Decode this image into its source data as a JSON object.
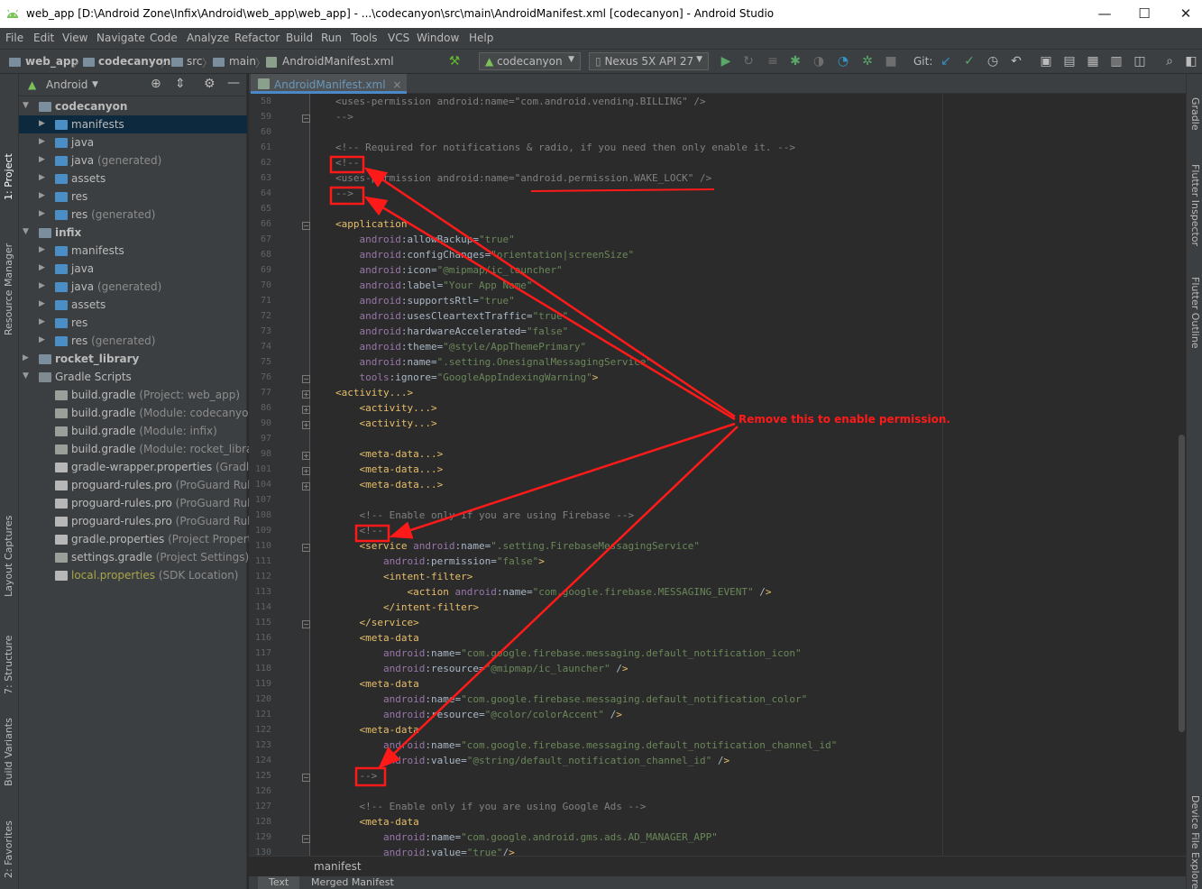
{
  "window": {
    "title": "web_app [D:\\Android Zone\\Infix\\Android\\web_app\\web_app] - ...\\codecanyon\\src\\main\\AndroidManifest.xml [codecanyon] - Android Studio",
    "minimize": "—",
    "maximize": "☐",
    "close": "✕"
  },
  "menu": [
    "File",
    "Edit",
    "View",
    "Navigate",
    "Code",
    "Analyze",
    "Refactor",
    "Build",
    "Run",
    "Tools",
    "VCS",
    "Window",
    "Help"
  ],
  "breadcrumbs": [
    "web_app",
    "codecanyon",
    "src",
    "main",
    "AndroidManifest.xml"
  ],
  "toolbar": {
    "run_config": "codecanyon",
    "device": "Nexus 5X API 27",
    "git_label": "Git:"
  },
  "left_tool_tabs": [
    "1: Project",
    "Resource Manager",
    "Layout Captures",
    "7: Structure",
    "Build Variants",
    "2: Favorites"
  ],
  "right_tool_tabs": [
    "Gradle",
    "Flutter Inspector",
    "Flutter Outline",
    "Device File Explorer"
  ],
  "project_panel": {
    "view_mode": "Android",
    "tree": [
      {
        "label": "codecanyon",
        "hint": "",
        "bold": true
      },
      {
        "label": "manifests",
        "hint": "",
        "bold": false
      },
      {
        "label": "java",
        "hint": "",
        "bold": false
      },
      {
        "label": "java",
        "hint": " (generated)",
        "bold": false
      },
      {
        "label": "assets",
        "hint": "",
        "bold": false
      },
      {
        "label": "res",
        "hint": "",
        "bold": false
      },
      {
        "label": "res",
        "hint": " (generated)",
        "bold": false
      },
      {
        "label": "infix",
        "hint": "",
        "bold": true
      },
      {
        "label": "manifests",
        "hint": "",
        "bold": false
      },
      {
        "label": "java",
        "hint": "",
        "bold": false
      },
      {
        "label": "java",
        "hint": " (generated)",
        "bold": false
      },
      {
        "label": "assets",
        "hint": "",
        "bold": false
      },
      {
        "label": "res",
        "hint": "",
        "bold": false
      },
      {
        "label": "res",
        "hint": " (generated)",
        "bold": false
      },
      {
        "label": "rocket_library",
        "hint": "",
        "bold": true
      },
      {
        "label": "Gradle Scripts",
        "hint": "",
        "bold": false
      },
      {
        "label": "build.gradle",
        "hint": " (Project: web_app)",
        "bold": false
      },
      {
        "label": "build.gradle",
        "hint": " (Module: codecanyon)",
        "bold": false
      },
      {
        "label": "build.gradle",
        "hint": " (Module: infix)",
        "bold": false
      },
      {
        "label": "build.gradle",
        "hint": " (Module: rocket_library)",
        "bold": false
      },
      {
        "label": "gradle-wrapper.properties",
        "hint": " (Gradle Ve",
        "bold": false
      },
      {
        "label": "proguard-rules.pro",
        "hint": " (ProGuard Rules f",
        "bold": false
      },
      {
        "label": "proguard-rules.pro",
        "hint": " (ProGuard Rules f",
        "bold": false
      },
      {
        "label": "proguard-rules.pro",
        "hint": " (ProGuard Rules f",
        "bold": false
      },
      {
        "label": "gradle.properties",
        "hint": " (Project Properties)",
        "bold": false
      },
      {
        "label": "settings.gradle",
        "hint": " (Project Settings)",
        "bold": false
      },
      {
        "label": "local.properties",
        "hint": " (SDK Location)",
        "bold": false
      }
    ]
  },
  "editor": {
    "tab": "AndroidManifest.xml",
    "breadcrumb": "manifest",
    "bottom_tabs": [
      "Text",
      "Merged Manifest"
    ],
    "line_numbers": [
      "58",
      "59",
      "60",
      "61",
      "62",
      "63",
      "64",
      "65",
      "66",
      "67",
      "68",
      "69",
      "70",
      "71",
      "72",
      "73",
      "74",
      "75",
      "76",
      "77",
      "86",
      "90",
      "97",
      "98",
      "101",
      "104",
      "107",
      "108",
      "109",
      "110",
      "111",
      "112",
      "113",
      "114",
      "115",
      "116",
      "117",
      "118",
      "119",
      "120",
      "121",
      "122",
      "123",
      "124",
      "125",
      "126",
      "127",
      "128",
      "129",
      "130"
    ],
    "lines": [
      "<uses-permission android:name=\"com.android.vending.BILLING\" />",
      "-->",
      "",
      "<!-- Required for notifications & radio, if you need then only enable it. -->",
      "<!--",
      "<uses-permission android:name=\"android.permission.WAKE_LOCK\" />",
      "-->",
      "",
      "<application",
      "    android:allowBackup=\"true\"",
      "    android:configChanges=\"orientation|screenSize\"",
      "    android:icon=\"@mipmap/ic_launcher\"",
      "    android:label=\"Your App Name\"",
      "    android:supportsRtl=\"true\"",
      "    android:usesCleartextTraffic=\"true\"",
      "    android:hardwareAccelerated=\"false\"",
      "    android:theme=\"@style/AppThemePrimary\"",
      "    android:name=\".setting.OnesignalMessagingService\"",
      "    tools:ignore=\"GoogleAppIndexingWarning\">",
      "<activity...>",
      "    <activity...>",
      "    <activity...>",
      "",
      "    <meta-data...>",
      "    <meta-data...>",
      "    <meta-data...>",
      "",
      "    <!-- Enable only if you are using Firebase -->",
      "    <!--",
      "    <service android:name=\".setting.FirebaseMessagingService\"",
      "        android:permission=\"false\">",
      "        <intent-filter>",
      "            <action android:name=\"com.google.firebase.MESSAGING_EVENT\" />",
      "        </intent-filter>",
      "    </service>",
      "    <meta-data",
      "        android:name=\"com.google.firebase.messaging.default_notification_icon\"",
      "        android:resource=\"@mipmap/ic_launcher\" />",
      "    <meta-data",
      "        android:name=\"com.google.firebase.messaging.default_notification_color\"",
      "        android:resource=\"@color/colorAccent\" />",
      "    <meta-data",
      "        android:name=\"com.google.firebase.messaging.default_notification_channel_id\"",
      "        android:value=\"@string/default_notification_channel_id\" />",
      "    -->",
      "",
      "    <!-- Enable only if you are using Google Ads -->",
      "    <meta-data",
      "        android:name=\"com.google.android.gms.ads.AD_MANAGER_APP\"",
      "        android:value=\"true\"/>"
    ]
  },
  "annotation": "Remove this to enable permission.",
  "colors": {
    "annotation": "#ff1a1a",
    "tag": "#e8bf6a",
    "comment": "#808080",
    "string": "#6a8759",
    "namespace": "#9876aa"
  }
}
